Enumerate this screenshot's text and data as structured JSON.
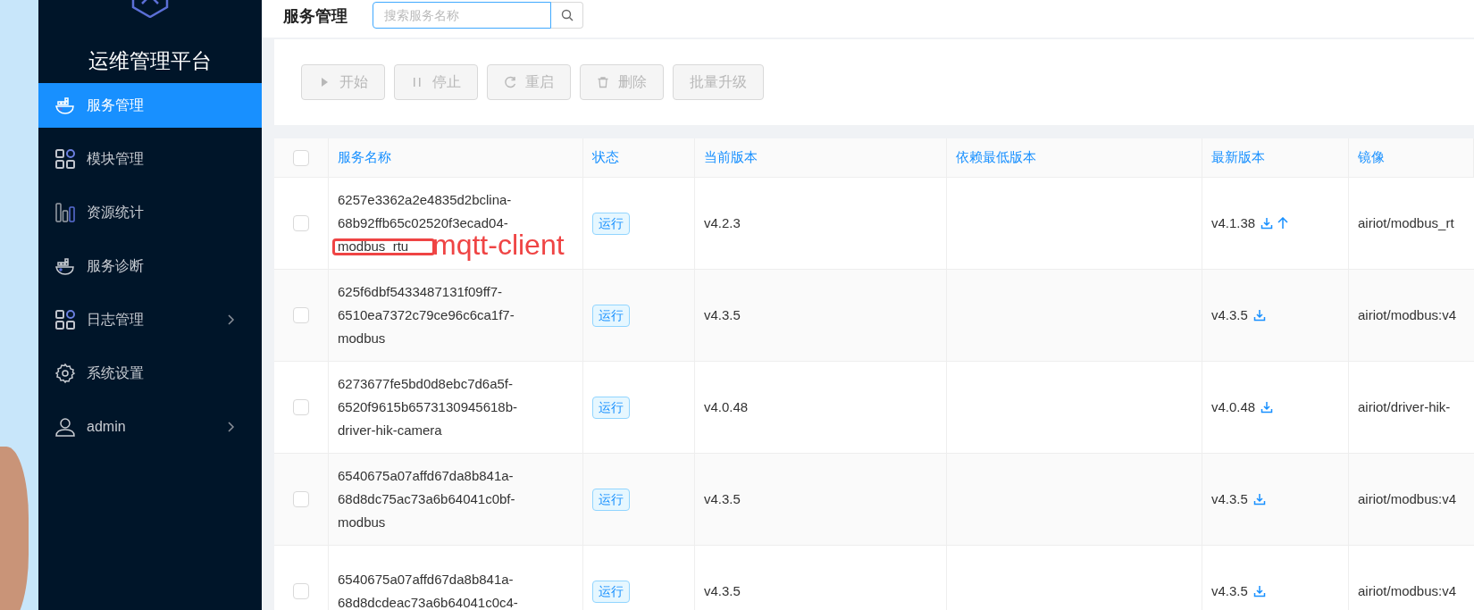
{
  "app_title": "运维管理平台",
  "sidebar": {
    "items": [
      {
        "label": "服务管理",
        "kind": "docker",
        "selected": true,
        "has_submenu": false
      },
      {
        "label": "模块管理",
        "kind": "grid",
        "selected": false,
        "has_submenu": false
      },
      {
        "label": "资源统计",
        "kind": "bars",
        "selected": false,
        "has_submenu": false
      },
      {
        "label": "服务诊断",
        "kind": "docker",
        "selected": false,
        "has_submenu": false
      },
      {
        "label": "日志管理",
        "kind": "grid",
        "selected": false,
        "has_submenu": true
      },
      {
        "label": "系统设置",
        "kind": "gear",
        "selected": false,
        "has_submenu": false
      },
      {
        "label": "admin",
        "kind": "user",
        "selected": false,
        "has_submenu": true
      }
    ]
  },
  "header": {
    "title": "服务管理",
    "search": {
      "placeholder": "搜索服务名称"
    }
  },
  "toolbar": [
    {
      "label": "开始",
      "kind": "play",
      "disabled": true
    },
    {
      "label": "停止",
      "kind": "pause",
      "disabled": true
    },
    {
      "label": "重启",
      "kind": "reload",
      "disabled": true
    },
    {
      "label": "删除",
      "kind": "trash",
      "disabled": true
    },
    {
      "label": "批量升级",
      "kind": "text",
      "disabled": true
    }
  ],
  "table": {
    "select_all_checked": false,
    "columns": [
      "服务名称",
      "状态",
      "当前版本",
      "依赖最低版本",
      "最新版本",
      "镜像"
    ],
    "rows": [
      {
        "checked": false,
        "name_lines": [
          "6257e3362a2e4835d2bclina-",
          "68b92ffb65c02520f3ecad04-",
          "modbus_rtu"
        ],
        "annotation": "mqtt-client",
        "status": "运行",
        "current_version": "v4.2.3",
        "latest_version": "v4.1.38",
        "upgrade_available": true,
        "image": "airiot/modbus_rt"
      },
      {
        "checked": false,
        "name_lines": [
          "625f6dbf5433487131f09ff7-",
          "6510ea7372c79ce96c6ca1f7-",
          "modbus"
        ],
        "status": "运行",
        "current_version": "v4.3.5",
        "latest_version": "v4.3.5",
        "upgrade_available": false,
        "image": "airiot/modbus:v4"
      },
      {
        "checked": false,
        "name_lines": [
          "6273677fe5bd0d8ebc7d6a5f-",
          "6520f9615b6573130945618b-",
          "driver-hik-camera"
        ],
        "status": "运行",
        "current_version": "v4.0.48",
        "latest_version": "v4.0.48",
        "upgrade_available": false,
        "image": "airiot/driver-hik-"
      },
      {
        "checked": false,
        "name_lines": [
          "6540675a07affd67da8b841a-",
          "68d8dc75ac73a6b64041c0bf-",
          "modbus"
        ],
        "status": "运行",
        "current_version": "v4.3.5",
        "latest_version": "v4.3.5",
        "upgrade_available": false,
        "image": "airiot/modbus:v4"
      },
      {
        "checked": false,
        "name_lines": [
          "6540675a07affd67da8b841a-",
          "68d8dcdeac73a6b64041c0c4-"
        ],
        "status": "运行",
        "current_version": "v4.3.5",
        "latest_version": "v4.3.5",
        "upgrade_available": false,
        "image": "airiot/modbus:v4"
      }
    ]
  }
}
